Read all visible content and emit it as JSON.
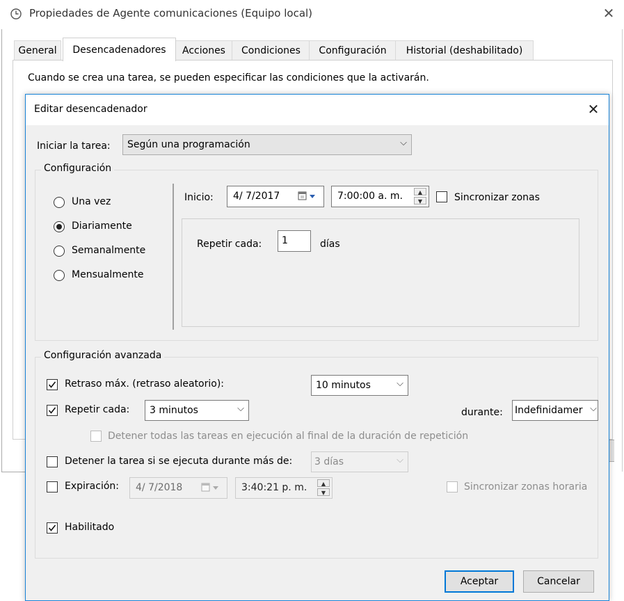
{
  "parent": {
    "title": "Propiedades de Agente comunicaciones (Equipo local)",
    "close_glyph": "✕",
    "tabs": [
      "General",
      "Desencadenadores",
      "Acciones",
      "Condiciones",
      "Configuración",
      "Historial (deshabilitado)"
    ],
    "active_tab": "Desencadenadores",
    "description": "Cuando se crea una tarea, se pueden especificar las condiciones que la activarán."
  },
  "dialog": {
    "title": "Editar desencadenador",
    "close_glyph": "✕",
    "start_task": {
      "label": "Iniciar la tarea:",
      "value": "Según una programación"
    },
    "config": {
      "label": "Configuración",
      "radios": [
        {
          "label": "Una vez",
          "checked": false
        },
        {
          "label": "Diariamente",
          "checked": true
        },
        {
          "label": "Semanalmente",
          "checked": false
        },
        {
          "label": "Mensualmente",
          "checked": false
        }
      ],
      "start_label": "Inicio:",
      "start_date": "4/  7/2017",
      "start_time": "7:00:00 a. m.",
      "sync_label": "Sincronizar zonas",
      "sync_checked": false,
      "repeat_label": "Repetir cada:",
      "repeat_value": "1",
      "repeat_unit": "días"
    },
    "advanced": {
      "label": "Configuración avanzada",
      "delay": {
        "label": "Retraso máx. (retraso aleatorio):",
        "checked": true,
        "value": "10 minutos"
      },
      "repeat": {
        "label": "Repetir cada:",
        "checked": true,
        "value": "3 minutos",
        "duration_label": "durante:",
        "duration_value": "Indefinidamer"
      },
      "stop_all": {
        "label": "Detener todas las tareas en ejecución al final de la duración de repetición",
        "checked": false,
        "enabled": false
      },
      "stop_if": {
        "label": "Detener la tarea si se ejecuta durante más de:",
        "checked": false,
        "value": "3 días"
      },
      "expire": {
        "label": "Expiración:",
        "checked": false,
        "date": "4/  7/2018",
        "time": "3:40:21 p. m.",
        "sync_label": "Sincronizar zonas horaria",
        "sync_checked": false
      },
      "enabled": {
        "label": "Habilitado",
        "checked": true
      }
    },
    "buttons": {
      "ok": "Aceptar",
      "cancel": "Cancelar"
    }
  },
  "colors": {
    "accent": "#0078d7",
    "dialog_border": "#1883d7",
    "dialog_bg": "#f0f0f0"
  }
}
